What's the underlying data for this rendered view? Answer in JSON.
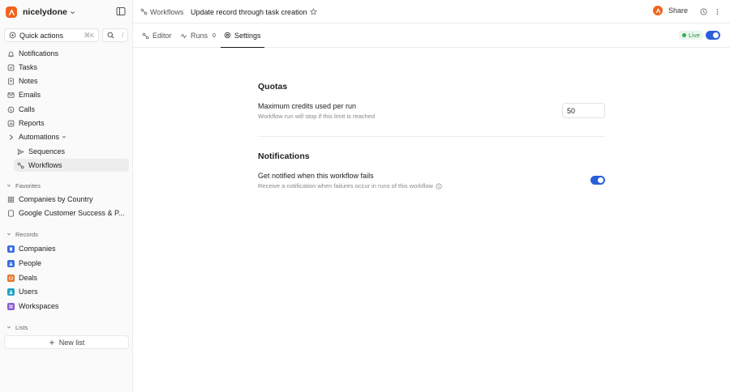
{
  "workspace": {
    "name": "nicelydone",
    "brand_color": "#f0641e"
  },
  "sidebar": {
    "quick_actions": {
      "label": "Quick actions",
      "shortcut": "⌘K"
    },
    "search": {
      "shortcut": "/"
    },
    "nav": [
      {
        "label": "Notifications",
        "icon": "bell-icon"
      },
      {
        "label": "Tasks",
        "icon": "check-square-icon"
      },
      {
        "label": "Notes",
        "icon": "note-icon"
      },
      {
        "label": "Emails",
        "icon": "mail-icon"
      },
      {
        "label": "Calls",
        "icon": "phone-icon"
      },
      {
        "label": "Reports",
        "icon": "reports-icon"
      },
      {
        "label": "Automations",
        "icon": "automations-icon"
      }
    ],
    "automations_sub": [
      {
        "label": "Sequences",
        "icon": "send-icon"
      },
      {
        "label": "Workflows",
        "icon": "workflow-icon",
        "active": true
      }
    ],
    "favorites": {
      "label": "Favorites",
      "items": [
        {
          "label": "Companies by Country",
          "icon": "grid-icon"
        },
        {
          "label": "Google Customer Success & P...",
          "icon": "document-icon"
        }
      ]
    },
    "records": {
      "label": "Records",
      "items": [
        {
          "label": "Companies",
          "icon": "building-icon",
          "color": "#3b6fe0"
        },
        {
          "label": "People",
          "icon": "person-icon",
          "color": "#3b6fe0"
        },
        {
          "label": "Deals",
          "icon": "deal-icon",
          "color": "#e8762c"
        },
        {
          "label": "Users",
          "icon": "user-icon",
          "color": "#22a3c4"
        },
        {
          "label": "Workspaces",
          "icon": "workspace-icon",
          "color": "#8a5cd6"
        }
      ]
    },
    "lists": {
      "label": "Lists",
      "new_list": "New list"
    }
  },
  "header": {
    "breadcrumb_parent": "Workflows",
    "title": "Update record through task creation",
    "share": "Share"
  },
  "tabs": [
    {
      "label": "Editor",
      "icon": "editor-icon"
    },
    {
      "label": "Runs",
      "icon": "runs-icon",
      "count": "0"
    },
    {
      "label": "Settings",
      "icon": "settings-icon",
      "active": true
    }
  ],
  "status": {
    "live_label": "Live",
    "live_enabled": true,
    "accent": "#2b5fd9"
  },
  "settings": {
    "quotas": {
      "heading": "Quotas",
      "max_credits_title": "Maximum credits used per run",
      "max_credits_desc": "Workflow run will stop if this limit is reached",
      "max_credits_value": "50"
    },
    "notifications": {
      "heading": "Notifications",
      "notify_title": "Get notified when this workflow fails",
      "notify_desc": "Receive a notification when failures occur in runs of this workflow",
      "notify_enabled": true
    }
  }
}
